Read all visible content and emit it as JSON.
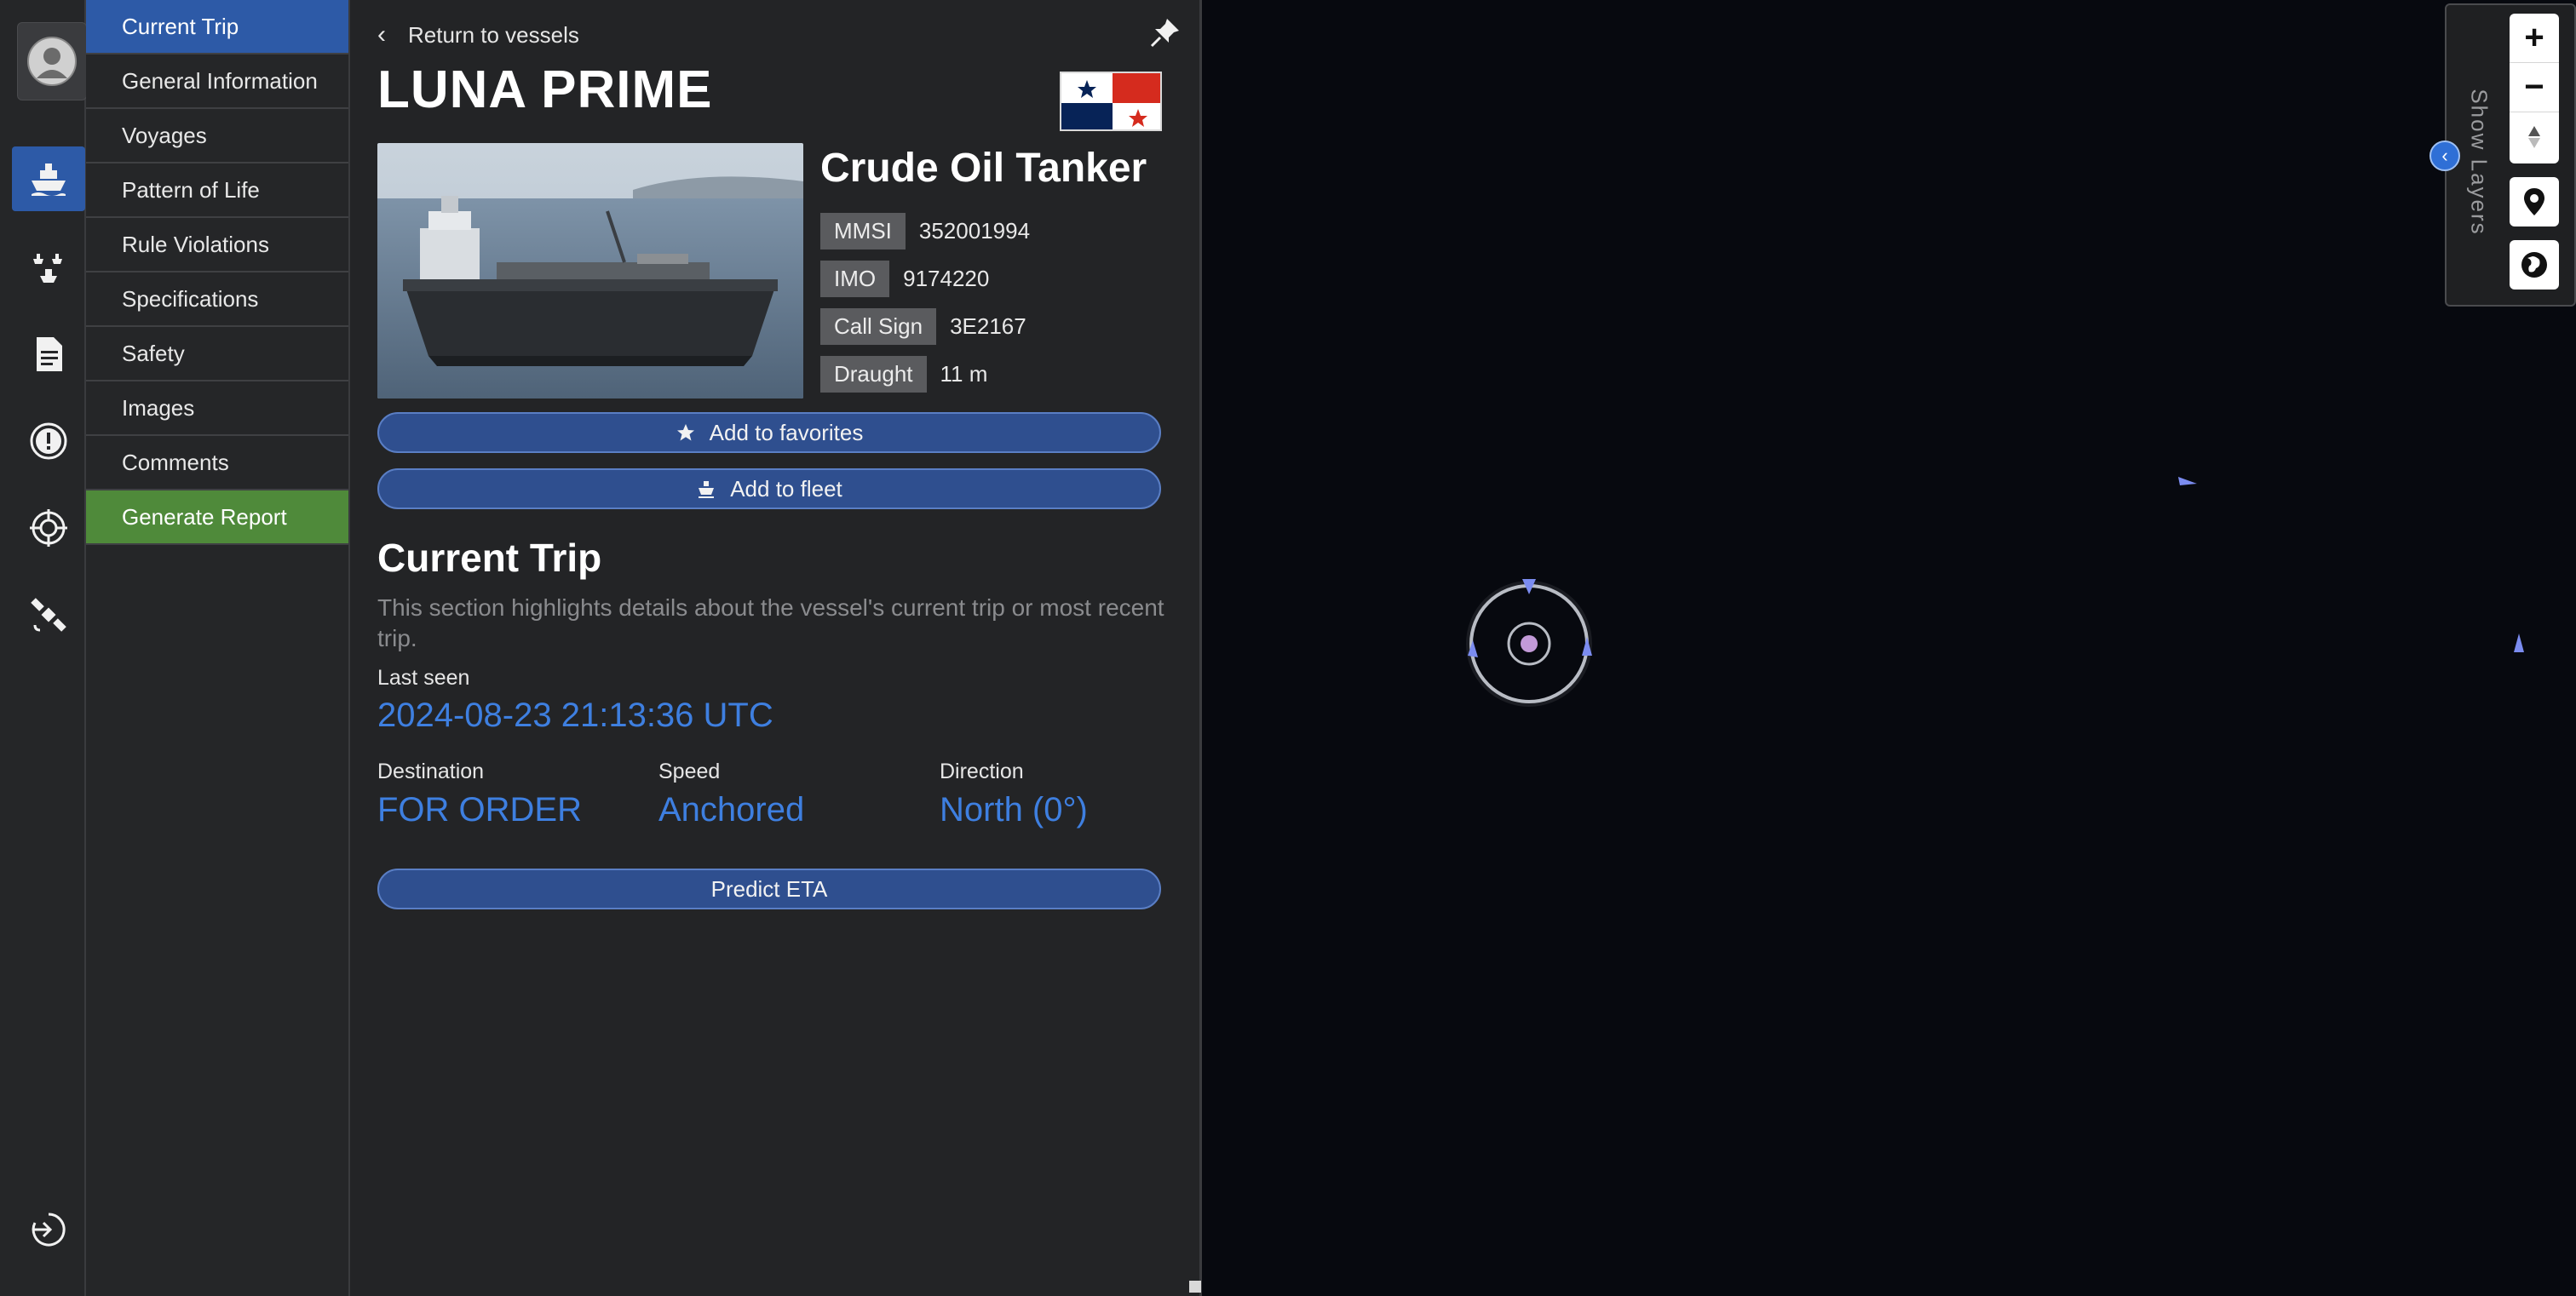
{
  "menu": {
    "items": [
      {
        "label": "Current Trip"
      },
      {
        "label": "General Information"
      },
      {
        "label": "Voyages"
      },
      {
        "label": "Pattern of Life"
      },
      {
        "label": "Rule Violations"
      },
      {
        "label": "Specifications"
      },
      {
        "label": "Safety"
      },
      {
        "label": "Images"
      },
      {
        "label": "Comments"
      },
      {
        "label": "Generate Report"
      }
    ]
  },
  "panel": {
    "back_label": "Return to vessels",
    "vessel_name": "LUNA PRIME",
    "vessel_type": "Crude Oil Tanker",
    "identifiers": [
      {
        "label": "MMSI",
        "value": "352001994"
      },
      {
        "label": "IMO",
        "value": "9174220"
      },
      {
        "label": "Call Sign",
        "value": "3E2167"
      },
      {
        "label": "Draught",
        "value": "11 m"
      }
    ],
    "favorites_label": "Add to favorites",
    "fleet_label": "Add to fleet",
    "section_title": "Current Trip",
    "section_desc": "This section highlights details about the vessel's current trip or most recent trip.",
    "last_seen_label": "Last seen",
    "last_seen_value": "2024-08-23 21:13:36 UTC",
    "stats": [
      {
        "label": "Destination",
        "value": "FOR ORDER"
      },
      {
        "label": "Speed",
        "value": "Anchored"
      },
      {
        "label": "Direction",
        "value": "North (0°)"
      }
    ],
    "predict_label": "Predict ETA"
  },
  "map": {
    "show_layers_label": "Show Layers",
    "zoom_in": "+",
    "zoom_out": "−"
  },
  "colors": {
    "accent_blue": "#2d5aa7",
    "value_blue": "#3e7fe0",
    "report_green": "#4f8a3a"
  }
}
